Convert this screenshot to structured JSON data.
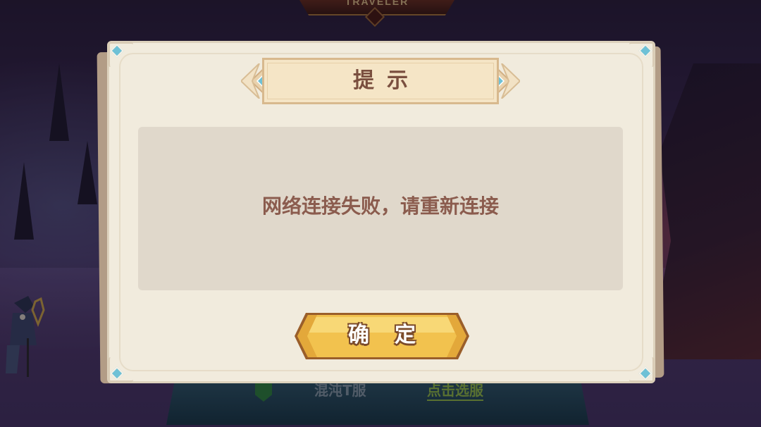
{
  "background": {
    "top_banner_text": "TRAVELER",
    "bottom_left_text": "混沌T服",
    "bottom_right_text": "点击选服"
  },
  "dialog": {
    "title": "提示",
    "message": "网络连接失败，请重新连接",
    "confirm_label": "确定"
  },
  "colors": {
    "dialog_bg": "#f1ebdd",
    "panel_bg": "#e0d8cb",
    "title_text": "#7a4f3f",
    "message_text": "#8b5c4e",
    "button_fill": "#f2c24e",
    "accent_gem": "#6ec1d6"
  }
}
